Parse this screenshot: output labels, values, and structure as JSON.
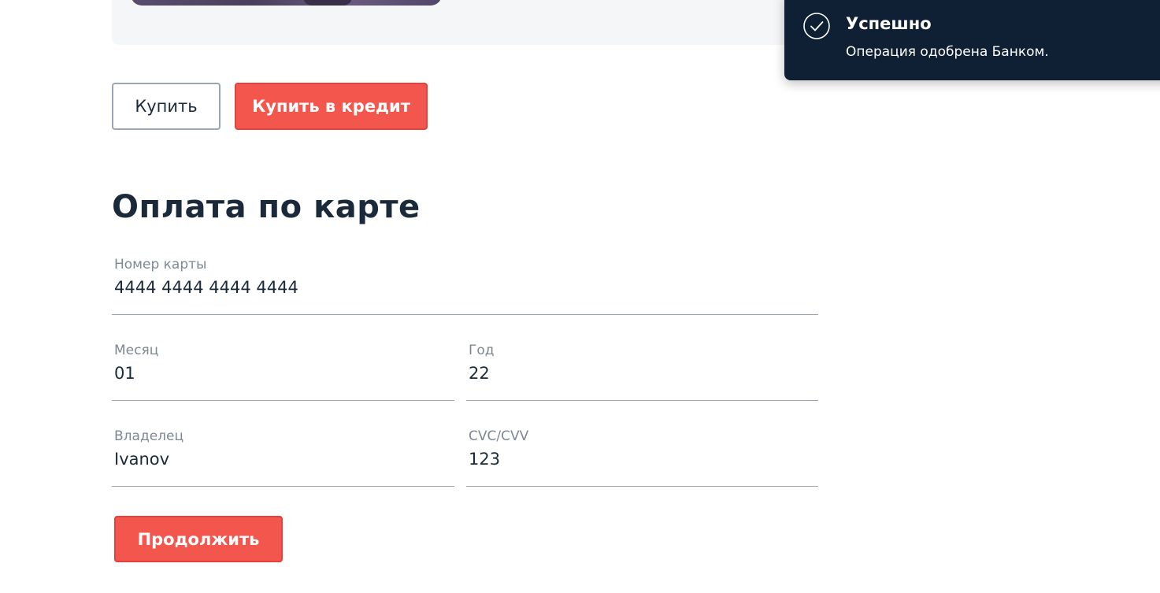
{
  "buttons": {
    "buy": "Купить",
    "buy_credit": "Купить в кредит",
    "continue": "Продолжить"
  },
  "form": {
    "title": "Оплата по карте",
    "card_number": {
      "label": "Номер карты",
      "value": "4444 4444 4444 4444"
    },
    "month": {
      "label": "Месяц",
      "value": "01"
    },
    "year": {
      "label": "Год",
      "value": "22"
    },
    "owner": {
      "label": "Владелец",
      "value": "Ivanov"
    },
    "cvc": {
      "label": "CVC/CVV",
      "value": "123"
    }
  },
  "notification": {
    "title": "Успешно",
    "message": "Операция одобрена Банком.",
    "icon": "check-circle-icon"
  },
  "colors": {
    "accent": "#f3564d",
    "notification_bg": "#0f2035",
    "text": "#1b2a3b"
  }
}
